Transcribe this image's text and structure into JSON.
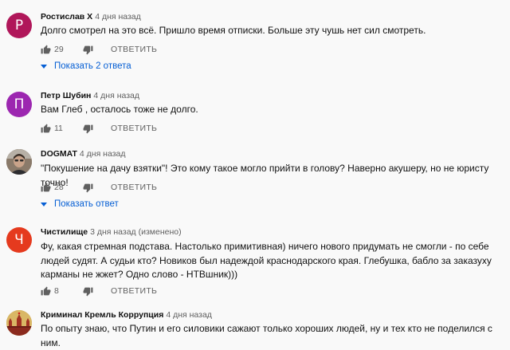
{
  "colors": {
    "link": "#065fd4",
    "muted": "#606060"
  },
  "comments": [
    {
      "avatar_letter": "Р",
      "avatar_color": "#b0175a",
      "author": "Ростислав Х",
      "time": "4 дня назад",
      "text": "Долго смотрел на это всё. Пришло время отписки. Больше эту чушь нет сил смотреть.",
      "likes": "29",
      "reply_label": "ОТВЕТИТЬ",
      "replies_label": "Показать 2 ответа"
    },
    {
      "avatar_letter": "П",
      "avatar_color": "#9c27b0",
      "author": "Петр Шубин",
      "time": "4 дня назад",
      "text": "Вам Глеб , осталось тоже не долго.",
      "likes": "11",
      "reply_label": "ОТВЕТИТЬ"
    },
    {
      "avatar_image": "man-photo",
      "author": "DOGMAT",
      "time": "4 дня назад",
      "text": "\"Покушение на дачу взятки\"! Это кому такое могло прийти в голову? Наверно акушеру, но не юристу точно!",
      "likes": "28",
      "reply_label": "ОТВЕТИТЬ",
      "replies_label": "Показать ответ"
    },
    {
      "avatar_letter": "Ч",
      "avatar_color": "#e53a1e",
      "author": "Чистилище",
      "time": "3 дня назад (изменено)",
      "text": "Фу, какая стремная подстава. Настолько примитивная) ничего нового придумать не смогли - по себе людей судят. А судьи кто? Новиков был надеждой краснодарского края. Глебушка, бабло за заказуху карманы не жжет? Одно слово - НТВшник)))",
      "likes": "8",
      "reply_label": "ОТВЕТИТЬ"
    },
    {
      "avatar_image": "kremlin-photo",
      "author": "Криминал Кремль Коррупция",
      "time": "4 дня назад",
      "text": "По опыту знаю, что Путин и его силовики сажают только хороших людей, ну и тех кто не поделился с ним."
    }
  ]
}
